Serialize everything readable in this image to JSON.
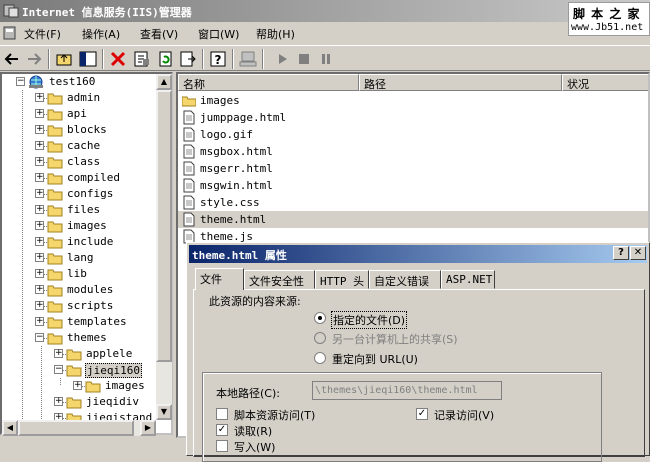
{
  "window": {
    "title": "Internet 信息服务(IIS)管理器",
    "watermark_top": "脚 本 之 家",
    "watermark_bottom": "www.Jb51.net"
  },
  "menu": [
    "文件(F)",
    "操作(A)",
    "查看(V)",
    "窗口(W)",
    "帮助(H)"
  ],
  "tree": {
    "root": "test160",
    "items": [
      "admin",
      "api",
      "blocks",
      "cache",
      "class",
      "compiled",
      "configs",
      "files",
      "images",
      "include",
      "lang",
      "lib",
      "modules",
      "scripts",
      "templates",
      "themes"
    ],
    "themes_children": [
      "applele",
      "jieqi160"
    ],
    "jieqi160_children": [
      "images"
    ],
    "after": [
      "jieqidiv",
      "jieqistand"
    ]
  },
  "list": {
    "columns": [
      "名称",
      "路径",
      "状况"
    ],
    "rows": [
      {
        "name": "images",
        "type": "folder"
      },
      {
        "name": "jumppage.html",
        "type": "file"
      },
      {
        "name": "logo.gif",
        "type": "file"
      },
      {
        "name": "msgbox.html",
        "type": "file"
      },
      {
        "name": "msgerr.html",
        "type": "file"
      },
      {
        "name": "msgwin.html",
        "type": "file"
      },
      {
        "name": "style.css",
        "type": "file"
      },
      {
        "name": "theme.html",
        "type": "file"
      },
      {
        "name": "theme.js",
        "type": "file"
      }
    ]
  },
  "dialog": {
    "title": "theme.html 属性",
    "help_btn": "?",
    "close_btn": "✕",
    "tabs": [
      "文件",
      "文件安全性",
      "HTTP 头",
      "自定义错误",
      "ASP.NET"
    ],
    "source_label": "此资源的内容来源:",
    "radio_file": "指定的文件(D)",
    "radio_share": "另一台计算机上的共享(S)",
    "radio_url": "重定向到 URL(U)",
    "local_path_label": "本地路径(C):",
    "local_path_value": "\\themes\\jieqi160\\theme.html",
    "chk_script": "脚本资源访问(T)",
    "chk_log": "记录访问(V)",
    "chk_read": "读取(R)",
    "chk_write": "写入(W)",
    "check_mark": "✓"
  },
  "colors": {
    "folder": "#f5d66c",
    "title_active": "#0a246a"
  }
}
